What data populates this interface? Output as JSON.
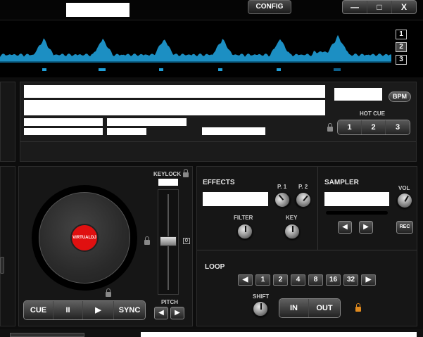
{
  "titlebar": {
    "config_label": "CONFIG",
    "minimize_label": "—",
    "maximize_label": "□",
    "close_label": "X"
  },
  "waveform": {
    "zoom_buttons": [
      "1",
      "2",
      "3"
    ],
    "active_zoom": "2",
    "color": "#1f9fd8"
  },
  "info": {
    "bpm_label": "BPM",
    "hot_cue_label": "HOT CUE",
    "hot_cues": [
      "1",
      "2",
      "3"
    ]
  },
  "deck": {
    "keylock_label": "KEYLOCK",
    "pitch_label": "PITCH",
    "pitch_zero": "0",
    "logo_text": "VIRTUALDJ",
    "transport": [
      "CUE",
      "II",
      "▶",
      "SYNC"
    ],
    "pitch_buttons": [
      "◀",
      "▶"
    ],
    "platter_label_color": "#e01010"
  },
  "effects": {
    "title": "EFFECTS",
    "p1_label": "P. 1",
    "p2_label": "P. 2",
    "filter_label": "FILTER",
    "key_label": "KEY"
  },
  "sampler": {
    "title": "SAMPLER",
    "vol_label": "VOL",
    "rec_label": "REC",
    "nav_buttons": [
      "◀",
      "▶"
    ]
  },
  "loop": {
    "title": "LOOP",
    "sizes": [
      "◀",
      "1",
      "2",
      "4",
      "8",
      "16",
      "32",
      "▶"
    ],
    "shift_label": "SHIFT",
    "in_label": "IN",
    "out_label": "OUT",
    "lock_color": "#e08a1e"
  }
}
